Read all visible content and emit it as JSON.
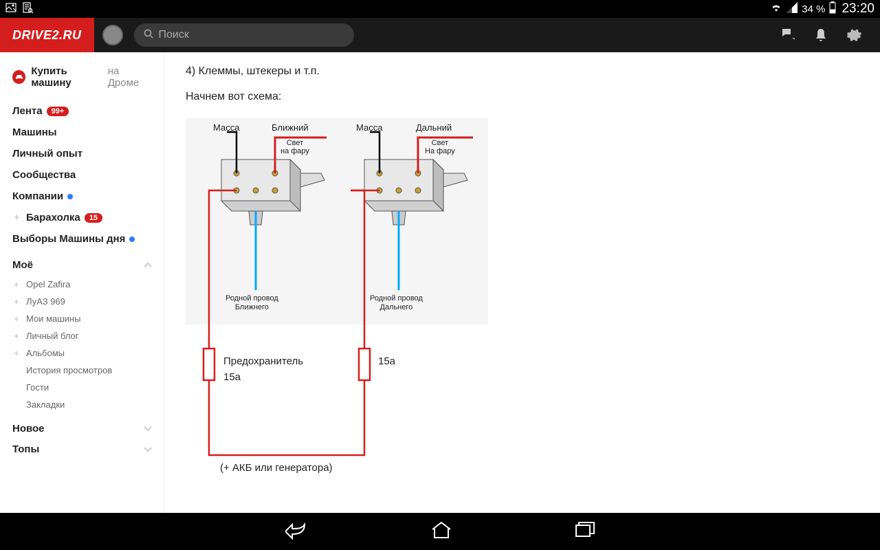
{
  "status": {
    "battery_pct": "34 %",
    "time": "23:20"
  },
  "header": {
    "logo": "DRIVE2.RU",
    "search_placeholder": "Поиск"
  },
  "sidebar": {
    "buy_car": {
      "bold": "Купить машину",
      "grey": " на Дроме"
    },
    "items_main": [
      {
        "label": "Лента",
        "badge": "99+"
      },
      {
        "label": "Машины"
      },
      {
        "label": "Личный опыт"
      },
      {
        "label": "Сообщества"
      },
      {
        "label": "Компании",
        "blue_dot": true
      },
      {
        "label": "Барахолка",
        "badge": "15",
        "plus": true
      },
      {
        "label": "Выборы Машины дня",
        "blue_dot": true
      }
    ],
    "moe_title": "Моё",
    "items_moe": [
      {
        "label": "Opel Zafira",
        "plus": true
      },
      {
        "label": "ЛуАЗ 969",
        "plus": true
      },
      {
        "label": "Мои машины",
        "plus": true
      },
      {
        "label": "Личный блог",
        "plus": true
      },
      {
        "label": "Альбомы",
        "plus": true
      },
      {
        "label": "История просмотров"
      },
      {
        "label": "Гости"
      },
      {
        "label": "Закладки"
      }
    ],
    "novoe_title": "Новое",
    "topy_title": "Топы"
  },
  "content": {
    "line4": "4) Клеммы, штекеры и т.п.",
    "intro": "Начнем вот схема:"
  },
  "diagram": {
    "mass1": "Масса",
    "mass2": "Масса",
    "near": "Ближний",
    "far": "Дальний",
    "light": "Свет",
    "tolamp": "на фару",
    "tolamp2": "На фару",
    "native_near1": "Родной провод",
    "native_near2": "Ближнего",
    "native_far1": "Родной провод",
    "native_far2": "Дальнего",
    "fuse": "Предохранитель",
    "amps": "15а",
    "source": "(+ АКБ или генератора)"
  }
}
